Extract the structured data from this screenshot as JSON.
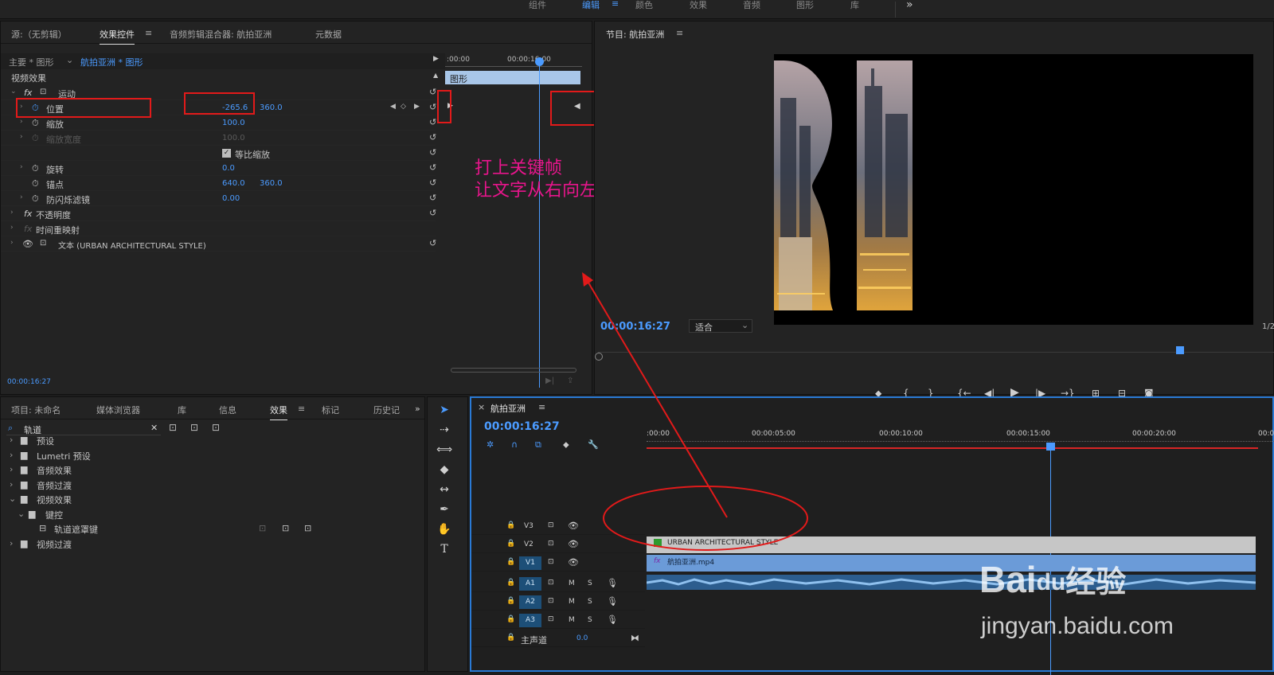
{
  "workspace_tabs": [
    "组件",
    "编辑",
    "颜色",
    "效果",
    "音频",
    "图形",
    "库"
  ],
  "workspace_overflow": "»",
  "effect_panel": {
    "tabs": [
      "源:（无剪辑）",
      "效果控件",
      "音频剪辑混合器: 航拍亚洲",
      "元数据"
    ],
    "master_label": "主要 * 图形",
    "clip_label": "航拍亚洲 * 图形",
    "section": "视频效果",
    "fx": "fx",
    "motion": "运动",
    "position": {
      "label": "位置",
      "x": "-265.6",
      "y": "360.0"
    },
    "scale": {
      "label": "缩放",
      "value": "100.0"
    },
    "scale_width": {
      "label": "缩放宽度",
      "value": "100.0"
    },
    "uniform_scale": "等比缩放",
    "rotation": {
      "label": "旋转",
      "value": "0.0"
    },
    "anchor": {
      "label": "锚点",
      "x": "640.0",
      "y": "360.0"
    },
    "antiflicker": {
      "label": "防闪烁滤镜",
      "value": "0.00"
    },
    "opacity": "不透明度",
    "time_remap": "时间重映射",
    "text_layer": "文本 (URBAN ARCHITECTURAL STYLE)",
    "timeline_ticks": [
      ":00:00",
      "00:00:16:00"
    ],
    "clip_bar": "图形",
    "timecode": "00:00:16:27"
  },
  "annotation": {
    "line1": "打上关键帧",
    "line2": "让文字从右向左移动",
    "color": "#e8158c"
  },
  "program_monitor": {
    "title": "节目: 航拍亚洲",
    "timecode": "00:00:16:27",
    "fit": "适合",
    "fraction": "1/2"
  },
  "project_panel": {
    "tabs": [
      "项目: 未命名",
      "媒体浏览器",
      "库",
      "信息",
      "效果",
      "标记",
      "历史记"
    ],
    "search_value": "轨道",
    "items": [
      {
        "label": "预设",
        "level": 0,
        "open": false
      },
      {
        "label": "Lumetri 预设",
        "level": 0,
        "open": false
      },
      {
        "label": "音频效果",
        "level": 0,
        "open": false
      },
      {
        "label": "音频过渡",
        "level": 0,
        "open": false
      },
      {
        "label": "视频效果",
        "level": 0,
        "open": true
      },
      {
        "label": "键控",
        "level": 1,
        "open": true
      },
      {
        "label": "轨道遮罩键",
        "level": 2,
        "open": false
      },
      {
        "label": "视频过渡",
        "level": 0,
        "open": false
      }
    ]
  },
  "timeline": {
    "title": "航拍亚洲",
    "timecode": "00:00:16:27",
    "ruler": [
      ":00:00",
      "00:00:05:00",
      "00:00:10:00",
      "00:00:15:00",
      "00:00:20:00",
      "00:0"
    ],
    "tracks": [
      {
        "name": "V3",
        "type": "video",
        "target": false
      },
      {
        "name": "V2",
        "type": "video",
        "target": false
      },
      {
        "name": "V1",
        "type": "video",
        "target": true
      },
      {
        "name": "A1",
        "type": "audio",
        "target": true
      },
      {
        "name": "A2",
        "type": "audio",
        "target": true
      },
      {
        "name": "A3",
        "type": "audio",
        "target": true
      }
    ],
    "master_track": "主声道",
    "master_value": "0.0",
    "clip_text": "URBAN ARCHITECTURAL STYLE",
    "clip_video": "航拍亚洲.mp4",
    "m": "M",
    "s": "S"
  },
  "watermark": {
    "brand": "Bai",
    "paw": "du",
    "cn": "经验",
    "url": "jingyan.baidu.com"
  }
}
